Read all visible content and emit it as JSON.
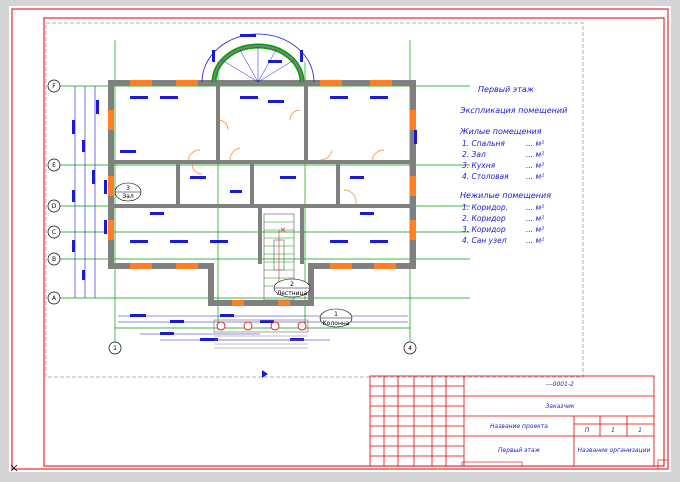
{
  "plan": {
    "title": "Первый этаж",
    "explication_title": "Экспликация помещений",
    "living_heading": "Жилые помещения",
    "living_rooms": [
      {
        "name": "1. Спальня",
        "area": "... м²"
      },
      {
        "name": "2. Зал",
        "area": "... м²"
      },
      {
        "name": "3. Кухня",
        "area": "... м²"
      },
      {
        "name": "4. Столовая",
        "area": "... м²"
      }
    ],
    "nonliving_heading": "Нежилые помещения",
    "nonliving_rooms": [
      {
        "name": "1. Коридор.",
        "area": "... м²"
      },
      {
        "name": "2. Коридор",
        "area": "... м²"
      },
      {
        "name": "3. Коридор",
        "area": "... м²"
      },
      {
        "name": "4. Сан узел",
        "area": "... м²"
      }
    ],
    "axes_letters": [
      "F",
      "E",
      "D",
      "C",
      "B",
      "A"
    ],
    "axes_numbers": [
      "1",
      "4"
    ],
    "room_tags": [
      {
        "num": "3",
        "name": "Зал"
      },
      {
        "num": "2",
        "name": "Лестница"
      },
      {
        "num": "1",
        "name": "Колонна"
      }
    ]
  },
  "title_block": {
    "doc_code": "---0001-2",
    "customer": "Заказчик",
    "project_name": "Название проекта",
    "sheet_name": "Первый этаж",
    "organization": "Название организации",
    "sheet_cells": [
      "П",
      "1",
      "1"
    ]
  },
  "colors": {
    "background": "#d4d4d4",
    "sheet": "#ffffff",
    "frame": "#e00000",
    "walls": "#808080",
    "dimensions": "#1a1ad6",
    "axes": "#00a000",
    "windows": "#ff7f27"
  }
}
